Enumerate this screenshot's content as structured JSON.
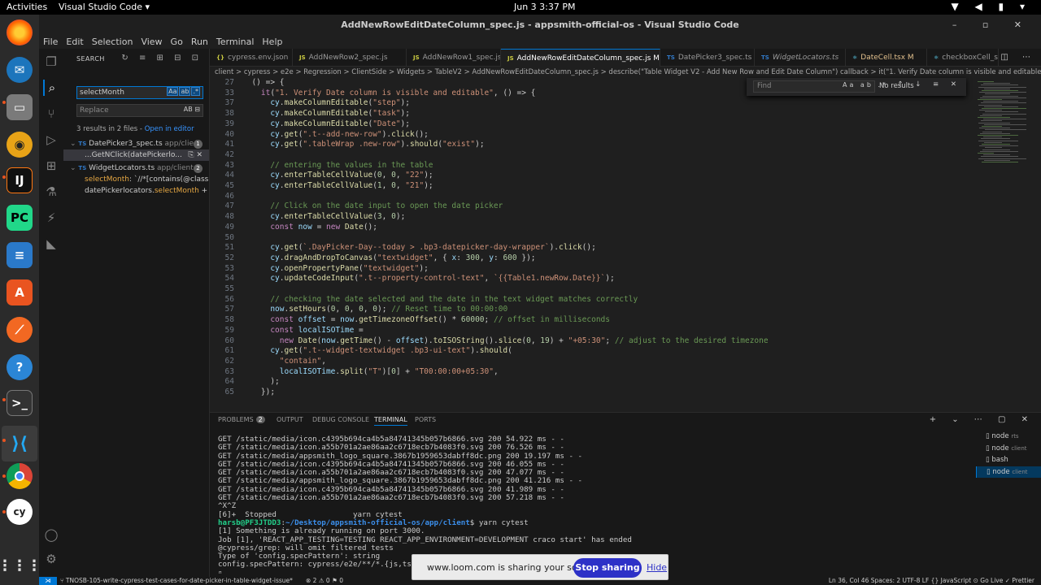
{
  "topbar": {
    "activities": "Activities",
    "app": "Visual Studio Code",
    "clock": "Jun 3  3:37 PM"
  },
  "window": {
    "title": "AddNewRowEditDateColumn_spec.js - appsmith-official-os - Visual Studio Code"
  },
  "menu": [
    "File",
    "Edit",
    "Selection",
    "View",
    "Go",
    "Run",
    "Terminal",
    "Help"
  ],
  "sidebar": {
    "header": "SEARCH",
    "search_value": "selectMonth",
    "replace_placeholder": "Replace",
    "summary_text": "3 results in 2 files - ",
    "open_in_editor": "Open in editor",
    "file1": {
      "name": "DatePicker3_spec.ts",
      "path": "app/clie...",
      "count": "1"
    },
    "file1_match": "...GetNClick(datePickerlo...",
    "file2": {
      "name": "WidgetLocators.ts",
      "path": "app/client...",
      "count": "2"
    },
    "file2_match1_hl": "selectMonth",
    "file2_match1_rest": ": `//*[contains(@class,'...",
    "file2_match2_pre": "datePickerlocators.",
    "file2_match2_hl": "selectMonth",
    "file2_match2_post": " + `[..."
  },
  "tabs": [
    {
      "label": "cypress.env.json"
    },
    {
      "label": "AddNewRow2_spec.js"
    },
    {
      "label": "AddNewRow1_spec.js"
    },
    {
      "label": "AddNewRowEditDateColumn_spec.js M"
    },
    {
      "label": "DatePicker3_spec.ts"
    },
    {
      "label": "WidgetLocators.ts"
    },
    {
      "label": "DateCell.tsx M"
    },
    {
      "label": "checkboxCell_s"
    }
  ],
  "breadcrumb": "client > cypress > e2e > Regression > ClientSide > Widgets > TableV2 > AddNewRowEditDateColumn_spec.js > describe(\"Table Widget V2 - Add New Row and Edit Date Column\") callback > it(\"1. Verify Date column is visible and editable\") callback",
  "find": {
    "placeholder": "Find",
    "result": "No results"
  },
  "code": [
    {
      "n": "27",
      "t": "  () => {"
    },
    {
      "n": "33",
      "t": "    it(\"1. Verify Date column is visible and editable\", () => {"
    },
    {
      "n": "37",
      "t": "      cy.makeColumnEditable(\"step\");"
    },
    {
      "n": "38",
      "t": "      cy.makeColumnEditable(\"task\");"
    },
    {
      "n": "39",
      "t": "      cy.makeColumnEditable(\"Date\");"
    },
    {
      "n": "40",
      "t": "      cy.get(\".t--add-new-row\").click();"
    },
    {
      "n": "41",
      "t": "      cy.get(\".tableWrap .new-row\").should(\"exist\");"
    },
    {
      "n": "42",
      "t": ""
    },
    {
      "n": "43",
      "t": "      // entering the values in the table"
    },
    {
      "n": "44",
      "t": "      cy.enterTableCellValue(0, 0, \"22\");"
    },
    {
      "n": "45",
      "t": "      cy.enterTableCellValue(1, 0, \"21\");"
    },
    {
      "n": "46",
      "t": ""
    },
    {
      "n": "47",
      "t": "      // Click on the date input to open the date picker"
    },
    {
      "n": "48",
      "t": "      cy.enterTableCellValue(3, 0);"
    },
    {
      "n": "49",
      "t": "      const now = new Date();"
    },
    {
      "n": "50",
      "t": ""
    },
    {
      "n": "51",
      "t": "      cy.get(`.DayPicker-Day--today > .bp3-datepicker-day-wrapper`).click();"
    },
    {
      "n": "52",
      "t": "      cy.dragAndDropToCanvas(\"textwidget\", { x: 300, y: 600 });"
    },
    {
      "n": "53",
      "t": "      cy.openPropertyPane(\"textwidget\");"
    },
    {
      "n": "54",
      "t": "      cy.updateCodeInput(\".t--property-control-text\", `{{Table1.newRow.Date}}`);"
    },
    {
      "n": "55",
      "t": ""
    },
    {
      "n": "56",
      "t": "      // checking the date selected and the date in the text widget matches correctly"
    },
    {
      "n": "57",
      "t": "      now.setHours(0, 0, 0, 0); // Reset time to 00:00:00"
    },
    {
      "n": "58",
      "t": "      const offset = now.getTimezoneOffset() * 60000; // offset in milliseconds"
    },
    {
      "n": "59",
      "t": "      const localISOTime ="
    },
    {
      "n": "60",
      "t": "        new Date(now.getTime() - offset).toISOString().slice(0, 19) + \"+05:30\"; // adjust to the desired timezone"
    },
    {
      "n": "61",
      "t": "      cy.get(\".t--widget-textwidget .bp3-ui-text\").should("
    },
    {
      "n": "62",
      "t": "        \"contain\","
    },
    {
      "n": "63",
      "t": "        localISOTime.split(\"T\")[0] + \"T00:00:00+05:30\","
    },
    {
      "n": "64",
      "t": "      );"
    },
    {
      "n": "65",
      "t": "    });"
    }
  ],
  "panel": {
    "problems": "PROBLEMS",
    "problems_count": "2",
    "output": "OUTPUT",
    "debug": "DEBUG CONSOLE",
    "terminal": "TERMINAL",
    "ports": "PORTS"
  },
  "terminal_lines": [
    "GET /static/media/icon.c4395b694ca4b5a84741345b057b6866.svg 200 54.922 ms - -",
    "GET /static/media/icon.a55b701a2ae86aa2c6718ecb7b4083f0.svg 200 76.526 ms - -",
    "GET /static/media/appsmith_logo_square.3867b1959653dabff8dc.png 200 19.197 ms - -",
    "GET /static/media/icon.c4395b694ca4b5a84741345b057b6866.svg 200 46.055 ms - -",
    "GET /static/media/icon.a55b701a2ae86aa2c6718ecb7b4083f0.svg 200 47.077 ms - -",
    "GET /static/media/appsmith_logo_square.3867b1959653dabff8dc.png 200 41.216 ms - -",
    "GET /static/media/icon.c4395b694ca4b5a84741345b057b6866.svg 200 41.989 ms - -",
    "GET /static/media/icon.a55b701a2ae86aa2c6718ecb7b4083f0.svg 200 57.218 ms - -",
    "^X^Z",
    "[6]+  Stopped                 yarn cytest",
    "harsb@PF3JTDD3:~/Desktop/appsmith-official-os/app/client$ yarn cytest",
    "[1] Something is already running on port 3000.",
    "Job [1], 'REACT_APP_TESTING=TESTING REACT_APP_ENVIRONMENT=DEVELOPMENT craco start' has ended",
    "@cypress/grep: will omit filtered tests",
    "Type of 'config.specPattern': string",
    "config.specPattern: cypress/e2e/**/*.{js,ts}",
    "▯"
  ],
  "terminals": [
    {
      "name": "node",
      "sub": "rts"
    },
    {
      "name": "node",
      "sub": "client"
    },
    {
      "name": "bash",
      "sub": ""
    },
    {
      "name": "node",
      "sub": "client"
    }
  ],
  "status": {
    "branch": "TNOSB-105-write-cypress-test-cases-for-date-picker-in-table-widget-issue*",
    "problems": "⊗ 2  ⚠ 0   ⚑ 0",
    "right": "Ln 36, Col 46    Spaces: 2    UTF-8    LF    {} JavaScript    ⊙ Go Live    ✓ Prettier"
  },
  "loom": {
    "message": "www.loom.com is sharing your screen.",
    "stop": "Stop sharing",
    "hide": "Hide"
  },
  "colors": {
    "accent": "#0078d4",
    "keyword": "#c586c0",
    "string": "#ce9178",
    "comment": "#6a9955",
    "func": "#dcdcaa",
    "var": "#9cdcfe",
    "num": "#b5cea8"
  }
}
